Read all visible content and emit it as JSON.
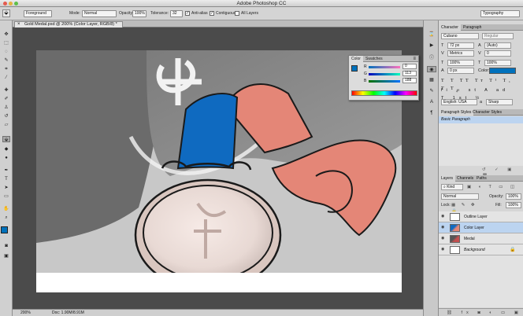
{
  "app": {
    "title": "Adobe Photoshop CC"
  },
  "options_bar": {
    "preset": "Foreground",
    "mode_label": "Mode:",
    "mode_value": "Normal",
    "opacity_label": "Opacity:",
    "opacity_value": "100%",
    "tolerance_label": "Tolerance:",
    "tolerance_value": "32",
    "antialias_label": "Anti-alias",
    "contiguous_label": "Contiguous",
    "all_layers_label": "All Layers",
    "workspace": "Typography"
  },
  "document": {
    "tab_label": "Gold Medal.psd @ 200% (Color Layer, RGB/8) *",
    "zoom": "200%",
    "doc_info": "Doc: 1.90M/8.91M"
  },
  "color_panel": {
    "tabs": [
      "Color",
      "Swatches"
    ],
    "channels": [
      {
        "label": "R",
        "value": "0"
      },
      {
        "label": "G",
        "value": "113"
      },
      {
        "label": "B",
        "value": "188"
      }
    ],
    "foreground_hex": "#0071bc"
  },
  "character_panel": {
    "tabs": [
      "Character",
      "Paragraph"
    ],
    "font_family": "Cubano",
    "font_style": "Regular",
    "size": "72 px",
    "leading": "(Auto)",
    "kerning": "Metrics",
    "tracking": "0",
    "vscale": "100%",
    "hscale": "100%",
    "baseline": "0 px",
    "color_label": "Color:",
    "color_hex": "#0071bc",
    "language": "English: USA",
    "antialias": "Sharp"
  },
  "paragraph_styles": {
    "tabs": [
      "Paragraph Styles",
      "Character Styles"
    ],
    "items": [
      "Basic Paragraph"
    ]
  },
  "layers_panel": {
    "tabs": [
      "Layers",
      "Channels",
      "Paths"
    ],
    "kind_filter": "Kind",
    "blend_mode": "Normal",
    "opacity_label": "Opacity:",
    "opacity": "100%",
    "lock_label": "Lock:",
    "fill_label": "Fill:",
    "fill": "100%",
    "layers": [
      {
        "name": "Outline Layer",
        "selected": false
      },
      {
        "name": "Color Layer",
        "selected": true
      },
      {
        "name": "Medal",
        "selected": false
      },
      {
        "name": "Background",
        "selected": false
      }
    ]
  },
  "colors": {
    "ribbon_blue": "#0f6ac0",
    "ribbon_red": "#e48677",
    "selection_blue": "#bcd4f0"
  }
}
